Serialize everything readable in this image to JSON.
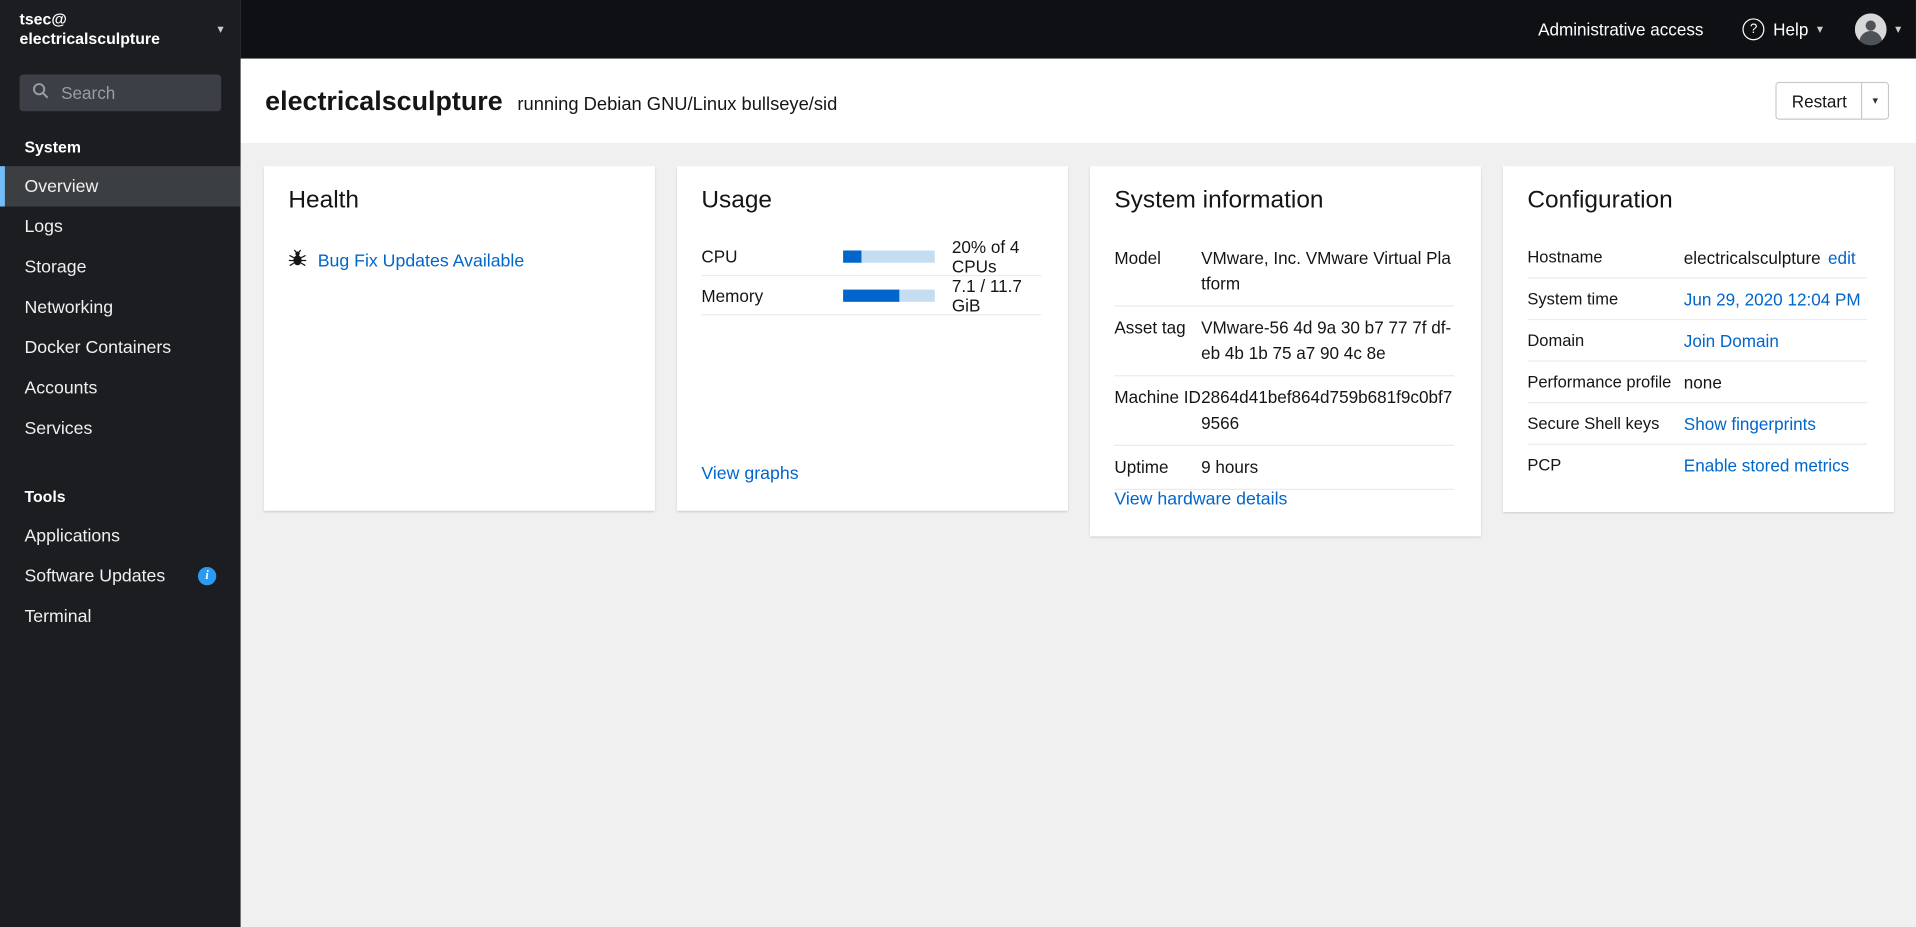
{
  "brand": {
    "user": "tsec@",
    "host": "electricalsculpture"
  },
  "masthead": {
    "admin_access": "Administrative access",
    "help_label": "Help"
  },
  "sidebar": {
    "search_placeholder": "Search",
    "sections": [
      {
        "label": "System",
        "items": [
          {
            "label": "Overview",
            "active": true
          },
          {
            "label": "Logs"
          },
          {
            "label": "Storage"
          },
          {
            "label": "Networking"
          },
          {
            "label": "Docker Containers"
          },
          {
            "label": "Accounts"
          },
          {
            "label": "Services"
          }
        ]
      },
      {
        "label": "Tools",
        "items": [
          {
            "label": "Applications"
          },
          {
            "label": "Software Updates",
            "badge": "info"
          },
          {
            "label": "Terminal"
          }
        ]
      }
    ]
  },
  "page_header": {
    "hostname": "electricalsculpture",
    "subtitle": "running Debian GNU/Linux bullseye/sid",
    "restart_label": "Restart"
  },
  "health": {
    "title": "Health",
    "update_link": "Bug Fix Updates Available"
  },
  "usage": {
    "title": "Usage",
    "cpu": {
      "label": "CPU",
      "percent": 20,
      "text": "20% of 4 CPUs"
    },
    "memory": {
      "label": "Memory",
      "percent": 61,
      "text": "7.1 / 11.7 GiB"
    },
    "footer_link": "View graphs"
  },
  "system_info": {
    "title": "System information",
    "rows": [
      {
        "label": "Model",
        "value": "VMware, Inc. VMware Virtual Platform"
      },
      {
        "label": "Asset tag",
        "value": "VMware-56 4d 9a 30 b7 77 7f df-eb 4b 1b 75 a7 90 4c 8e"
      },
      {
        "label": "Machine ID",
        "value": "2864d41bef864d759b681f9c0bf79566"
      },
      {
        "label": "Uptime",
        "value": "9 hours"
      }
    ],
    "footer_link": "View hardware details"
  },
  "configuration": {
    "title": "Configuration",
    "rows": [
      {
        "label": "Hostname",
        "value": "electricalsculpture",
        "link": "edit"
      },
      {
        "label": "System time",
        "link": "Jun 29, 2020 12:04 PM"
      },
      {
        "label": "Domain",
        "link": "Join Domain"
      },
      {
        "label": "Performance profile",
        "value": "none"
      },
      {
        "label": "Secure Shell keys",
        "link": "Show fingerprints"
      },
      {
        "label": "PCP",
        "link": "Enable stored metrics"
      }
    ]
  },
  "colors": {
    "accent_link": "#0066cc",
    "nav_active_border": "#73bcf7",
    "progress_fill": "#0066cc",
    "progress_track": "#c5ddf1",
    "masthead_bg": "#0e1013",
    "sidebar_bg": "#1b1d21",
    "info_badge": "#2b9af3"
  }
}
